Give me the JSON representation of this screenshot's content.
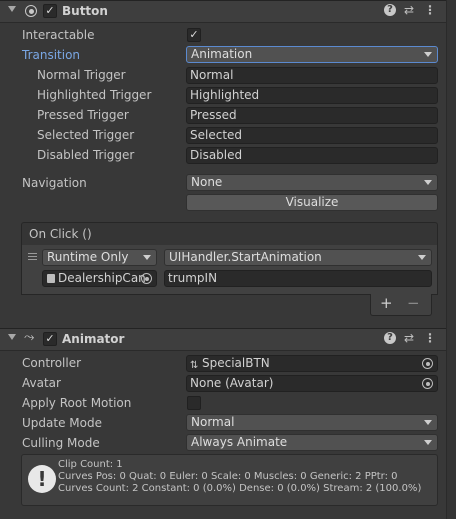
{
  "button_component": {
    "title": "Button",
    "interactable_label": "Interactable",
    "transition_label": "Transition",
    "transition_value": "Animation",
    "triggers": [
      {
        "label": "Normal Trigger",
        "value": "Normal"
      },
      {
        "label": "Highlighted Trigger",
        "value": "Highlighted"
      },
      {
        "label": "Pressed Trigger",
        "value": "Pressed"
      },
      {
        "label": "Selected Trigger",
        "value": "Selected"
      },
      {
        "label": "Disabled Trigger",
        "value": "Disabled"
      }
    ],
    "navigation_label": "Navigation",
    "navigation_value": "None",
    "visualize_label": "Visualize",
    "on_click": {
      "header": "On Click ()",
      "runtime_value": "Runtime Only",
      "function_value": "UIHandler.StartAnimation",
      "target_object": "DealershipCan",
      "argument": "trumpIN",
      "add_label": "+",
      "remove_label": "−"
    }
  },
  "animator_component": {
    "title": "Animator",
    "controller_label": "Controller",
    "controller_value": "SpecialBTN",
    "avatar_label": "Avatar",
    "avatar_value": "None (Avatar)",
    "apply_root_motion_label": "Apply Root Motion",
    "update_mode_label": "Update Mode",
    "update_mode_value": "Normal",
    "culling_mode_label": "Culling Mode",
    "culling_mode_value": "Always Animate",
    "info": {
      "line1": "Clip Count: 1",
      "line2": "Curves Pos: 0 Quat: 0 Euler: 0 Scale: 0 Muscles: 0 Generic: 2 PPtr: 0",
      "line3": "Curves Count: 2 Constant: 0 (0.0%) Dense: 0 (0.0%) Stream: 2 (100.0%)"
    }
  },
  "header_icons": [
    "help-icon",
    "presets-icon",
    "more-menu-icon"
  ],
  "checked_glyph": "✓",
  "colors": {
    "accent_label": "#7aa7e4",
    "background": "#383838",
    "field": "#2a2a2a"
  }
}
